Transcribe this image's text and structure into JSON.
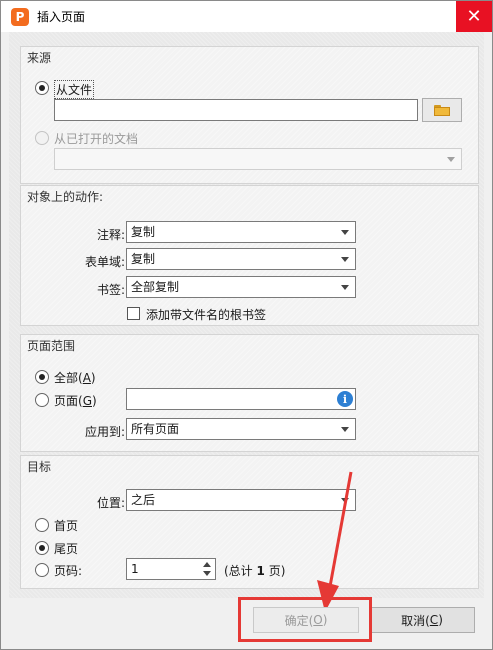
{
  "window": {
    "title": "插入页面",
    "close_glyph": "✕",
    "app_icon_letter": "P",
    "app_icon_color": "#f36c1f"
  },
  "source": {
    "header": "来源",
    "from_file_label": "从文件",
    "file_path_value": "",
    "from_open_docs_label": "从已打开的文档",
    "open_docs_selected": ""
  },
  "actions": {
    "header": "对象上的动作:",
    "annotations_label": "注释:",
    "annotations_value": "复制",
    "form_fields_label": "表单域:",
    "form_fields_value": "复制",
    "bookmarks_label": "书签:",
    "bookmarks_value": "全部复制",
    "add_root_bookmark_label": "添加带文件名的根书签",
    "add_root_bookmark_checked": false
  },
  "page_range": {
    "header": "页面范围",
    "all_label": "全部(",
    "all_key": "A",
    "all_label_end": ")",
    "pages_label": "页面(",
    "pages_key": "G",
    "pages_label_end": ")",
    "pages_value": "",
    "apply_to_label": "应用到:",
    "apply_to_value": "所有页面",
    "selected": "all"
  },
  "target": {
    "header": "目标",
    "position_label": "位置:",
    "position_value": "之后",
    "first_page_label": "首页",
    "last_page_label": "尾页",
    "page_number_label": "页码:",
    "page_number_value": "1",
    "total_prefix": "(总计",
    "total_count": "1",
    "total_suffix": "页)",
    "selected": "last"
  },
  "buttons": {
    "ok_label": "确定(",
    "ok_key": "O",
    "ok_end": ")",
    "cancel_label": "取消(",
    "cancel_key": "C",
    "cancel_end": ")"
  },
  "annotation_color": "#e53935"
}
